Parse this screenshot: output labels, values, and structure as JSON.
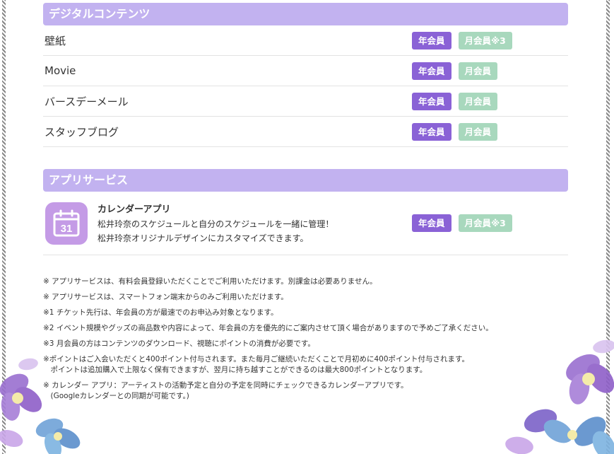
{
  "digital": {
    "header": "デジタルコンテンツ",
    "items": [
      {
        "label": "壁紙",
        "year_badge": "年会員",
        "month_badge": "月会員※3"
      },
      {
        "label": "Movie",
        "year_badge": "年会員",
        "month_badge": "月会員"
      },
      {
        "label": "バースデーメール",
        "year_badge": "年会員",
        "month_badge": "月会員"
      },
      {
        "label": "スタッフブログ",
        "year_badge": "年会員",
        "month_badge": "月会員"
      }
    ]
  },
  "apps": {
    "header": "アプリサービス",
    "calendar": {
      "icon_number": "31",
      "title": "カレンダーアプリ",
      "desc1": "松井玲奈のスケジュールと自分のスケジュールを一緒に管理！",
      "desc2": "松井玲奈オリジナルデザインにカスタマイズできます。",
      "year_badge": "年会員",
      "month_badge": "月会員※3"
    }
  },
  "notes": [
    "※ アプリサービスは、有料会員登録いただくことでご利用いただけます。別課金は必要ありません。",
    "※ アプリサービスは、スマートフォン端末からのみご利用いただけます。",
    "※1 チケット先行は、年会員の方が最速でのお申込み対象となります。",
    "※2 イベント規模やグッズの商品数や内容によって、年会員の方を優先的にご案内させて頂く場合がありますので予めご了承ください。",
    "※3 月会員の方はコンテンツのダウンロード、視聴にポイントの消費が必要です。",
    "※ポイントはご入会いただくと400ポイント付与されます。また毎月ご継続いただくことで月初めに400ポイント付与されます。\n　ポイントは追加購入で上限なく保有できますが、翌月に持ち越すことができるのは最大800ポイントとなります。",
    "※ カレンダー アプリ：アーティストの活動予定と自分の予定を同時にチェックできるカレンダーアプリです。\n　(Googleカレンダーとの同期が可能です。)"
  ],
  "colors": {
    "header_bg": "#c2b2f0",
    "year_badge": "#8a62d6",
    "month_badge": "#a8d8bd",
    "app_icon": "#c49be6"
  },
  "icons": [
    "calendar-icon",
    "flower-decoration"
  ]
}
